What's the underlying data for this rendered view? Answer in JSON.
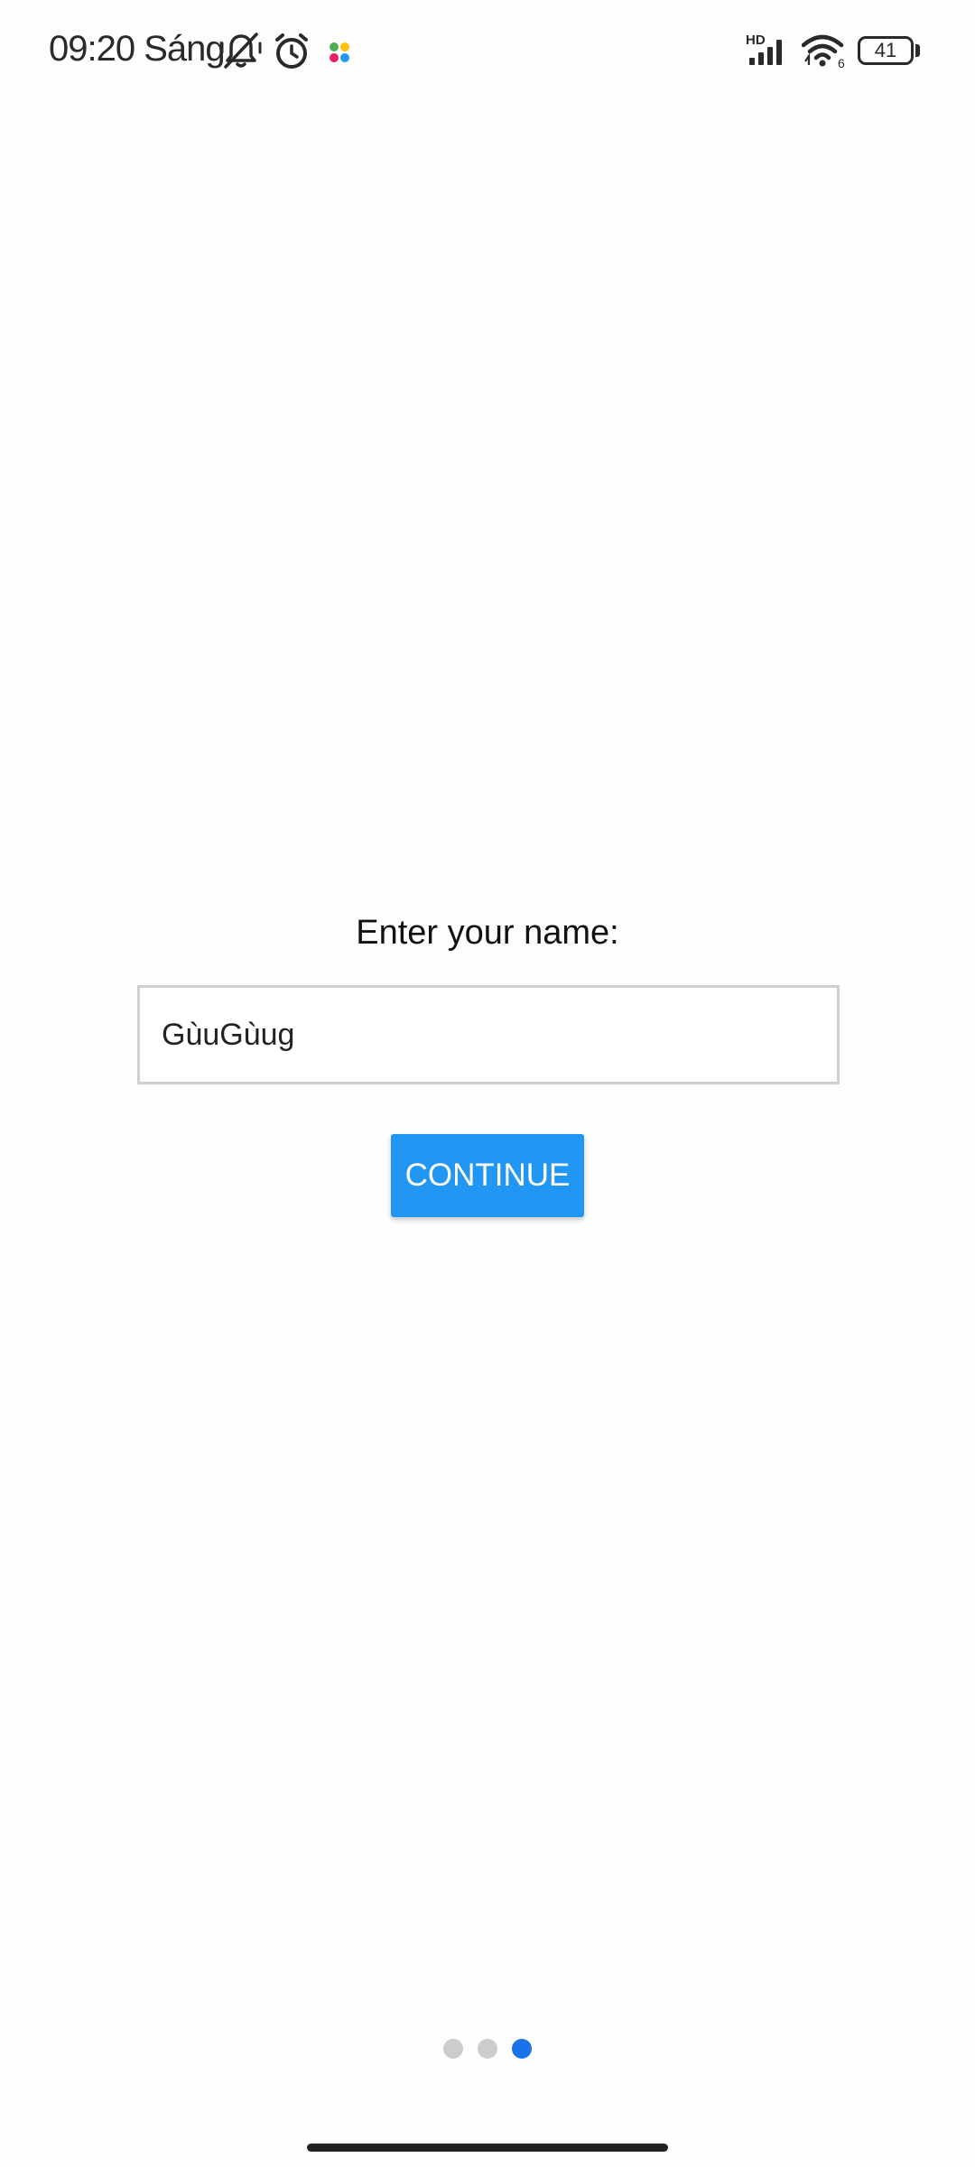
{
  "status_bar": {
    "time": "09:20 Sáng",
    "network_label": "HD",
    "wifi_label": "6",
    "battery_level": "41",
    "icons": [
      "bell-muted-icon",
      "alarm-icon",
      "app-notification-icon",
      "signal-icon",
      "wifi-icon",
      "battery-icon"
    ]
  },
  "form": {
    "prompt": "Enter your name:",
    "name_value": "GùuGùug",
    "continue_label": "CONTINUE"
  },
  "pager": {
    "total": 3,
    "active_index": 2
  },
  "colors": {
    "accent": "#2196f3",
    "active_dot": "#1a73e8",
    "inactive_dot": "#cccccc"
  }
}
